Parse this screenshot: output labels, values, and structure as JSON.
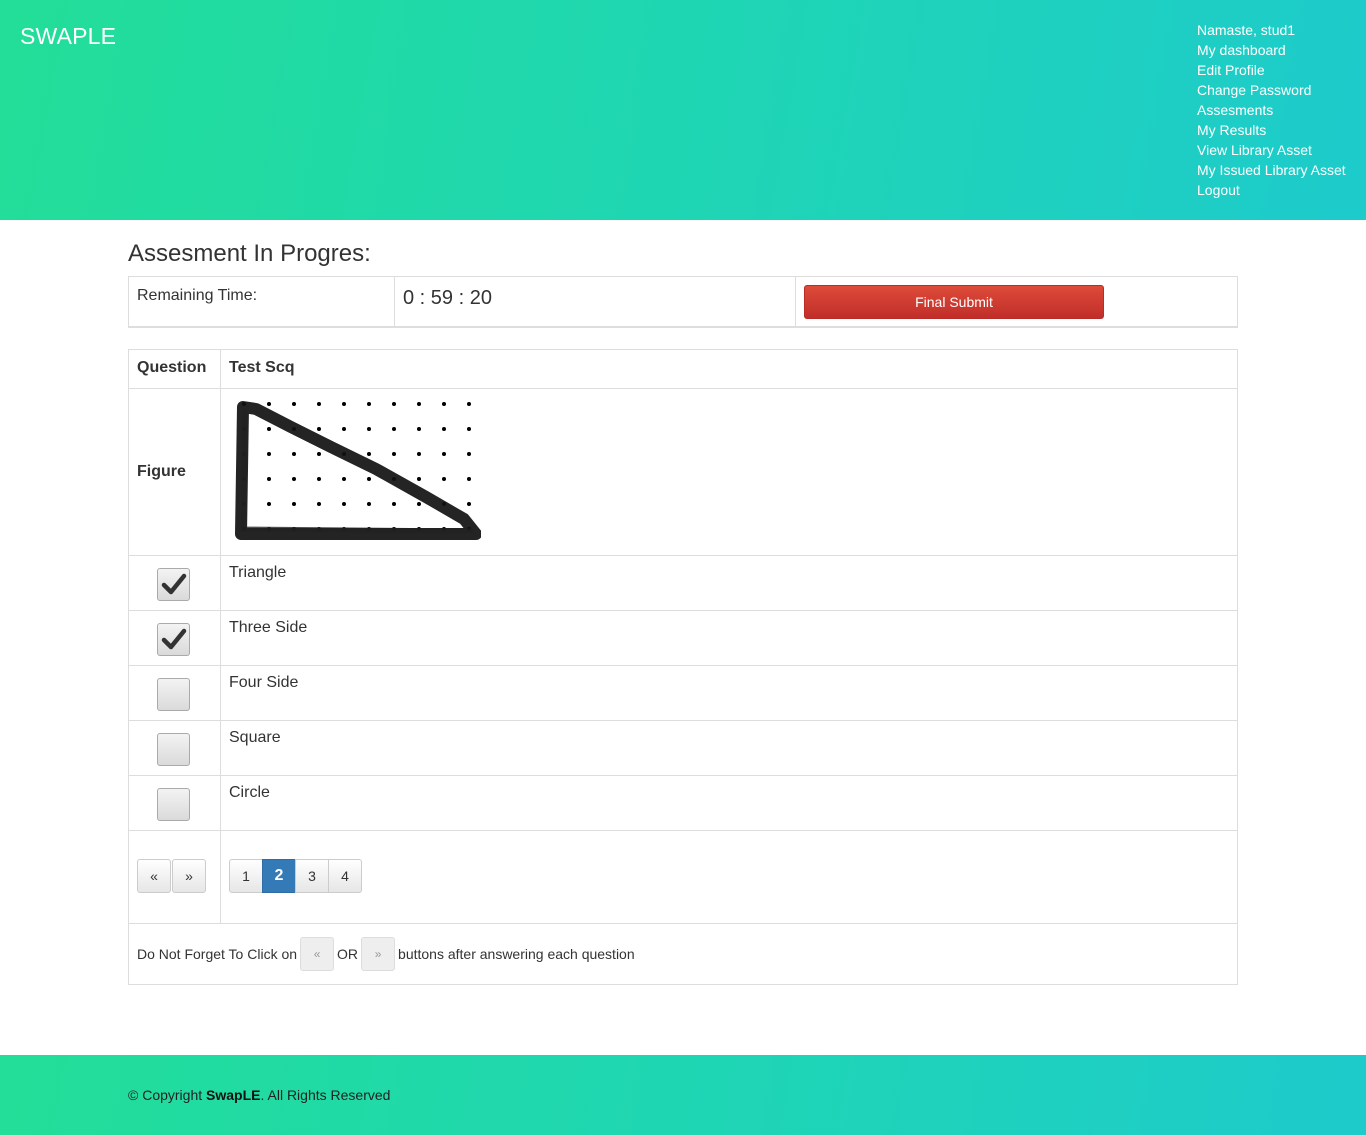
{
  "header": {
    "brand": "SWAPLE",
    "menu": [
      "Namaste, stud1",
      "My dashboard",
      "Edit Profile",
      "Change Password",
      "Assesments",
      "My Results",
      "View Library Asset",
      "My Issued Library Asset",
      "Logout"
    ]
  },
  "main": {
    "title": "Assesment In Progres:",
    "timer_label": "Remaining Time:",
    "timer_value": "0 : 59 : 20",
    "submit_label": "Final Submit",
    "question_label": "Question",
    "question_text": "Test Scq",
    "figure_label": "Figure",
    "figure_icon": "triangle-on-dot-grid",
    "options": [
      {
        "label": "Triangle",
        "checked": true
      },
      {
        "label": "Three Side",
        "checked": true
      },
      {
        "label": "Four Side",
        "checked": false
      },
      {
        "label": "Square",
        "checked": false
      },
      {
        "label": "Circle",
        "checked": false
      }
    ],
    "prev_label": "«",
    "next_label": "»",
    "pages": [
      "1",
      "2",
      "3",
      "4"
    ],
    "current_page": "2",
    "note_prefix": "Do Not Forget To Click on",
    "note_or": "OR",
    "note_suffix": "buttons after answering each question"
  },
  "footer": {
    "copy_prefix": "© Copyright",
    "copy_brand": "SwapLE",
    "copy_suffix": ". All Rights Reserved"
  },
  "colors": {
    "header_gradient_start": "#22de98",
    "header_gradient_end": "#1dcbcb",
    "submit_red": "#d43f3a",
    "active_page_blue": "#337ab7"
  }
}
